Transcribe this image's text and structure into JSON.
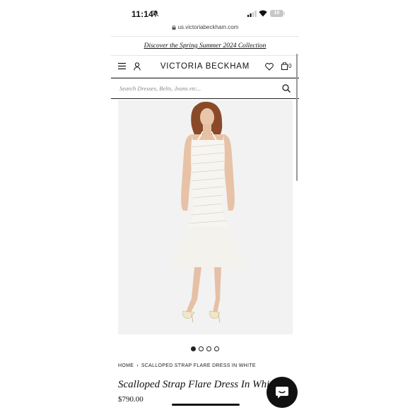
{
  "status_bar": {
    "time": "11:14",
    "battery": "10"
  },
  "browser": {
    "url": "us.victoriabeckham.com"
  },
  "promo_banner": {
    "text": "Discover the Spring Summer 2024 Collection"
  },
  "header": {
    "brand": "VICTORIA BECKHAM",
    "bag_count": "0"
  },
  "search": {
    "placeholder": "Search Dresses, Belts, Jeans etc..."
  },
  "carousel": {
    "total": 4,
    "active": 0
  },
  "breadcrumb": {
    "home": "HOME",
    "separator": "›",
    "current": "SCALLOPED STRAP FLARE DRESS IN WHITE"
  },
  "product": {
    "title": "Scalloped Strap Flare Dress In White",
    "price": "$790.00"
  },
  "icons": [
    "bell-muted-icon",
    "signal-icon",
    "wifi-icon",
    "lock-icon",
    "menu-icon",
    "account-icon",
    "heart-icon",
    "bag-icon",
    "search-icon",
    "chat-icon"
  ],
  "colors": {
    "accent": "#111111",
    "image_background": "#f2f2f2",
    "dress": "#f7f5f0"
  }
}
